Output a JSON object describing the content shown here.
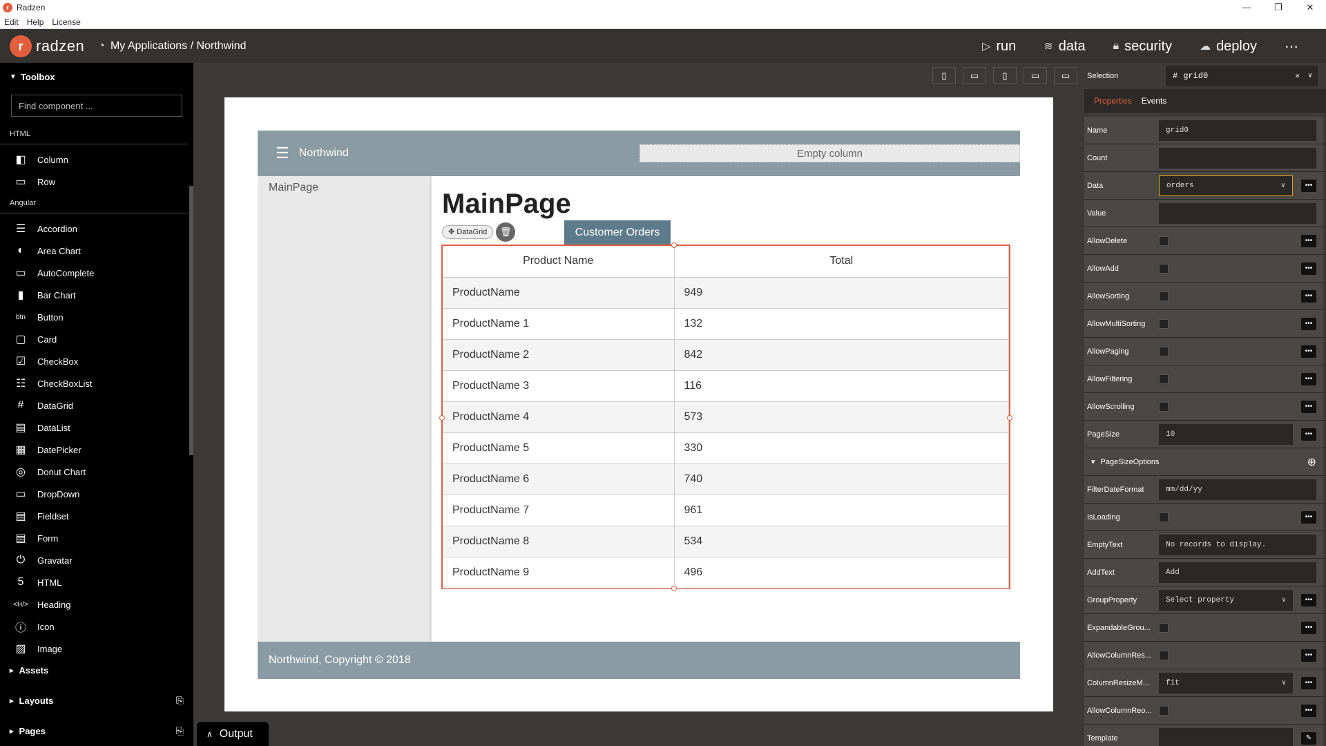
{
  "titlebar": {
    "title": "Radzen",
    "controls": [
      "—",
      "❐",
      "✕"
    ]
  },
  "menubar": {
    "items": [
      "Edit",
      "Help",
      "License"
    ]
  },
  "header": {
    "logo": "radzen",
    "breadcrumb": "My Applications / Northwind",
    "nav": [
      {
        "icon": "play-icon",
        "label": "run",
        "glyph": "▷"
      },
      {
        "icon": "database-icon",
        "label": "data",
        "glyph": "≋"
      },
      {
        "icon": "lock-icon",
        "label": "security",
        "glyph": "🔒︎"
      },
      {
        "icon": "cloud-upload-icon",
        "label": "deploy",
        "glyph": "☁"
      }
    ],
    "more": "⋯"
  },
  "toolbox": {
    "title": "Toolbox",
    "search_placeholder": "Find component ...",
    "sections": [
      {
        "title": "HTML",
        "items": [
          {
            "label": "Column",
            "glyph": "◧"
          },
          {
            "label": "Row",
            "glyph": "▭"
          }
        ]
      },
      {
        "title": "Angular",
        "items": [
          {
            "label": "Accordion",
            "glyph": "☰"
          },
          {
            "label": "Area Chart",
            "glyph": "◐"
          },
          {
            "label": "AutoComplete",
            "glyph": "▭"
          },
          {
            "label": "Bar Chart",
            "glyph": "▮"
          },
          {
            "label": "Button",
            "glyph": "btn"
          },
          {
            "label": "Card",
            "glyph": "▢"
          },
          {
            "label": "CheckBox",
            "glyph": "☑"
          },
          {
            "label": "CheckBoxList",
            "glyph": "☷"
          },
          {
            "label": "DataGrid",
            "glyph": "#"
          },
          {
            "label": "DataList",
            "glyph": "▤"
          },
          {
            "label": "DatePicker",
            "glyph": "▦"
          },
          {
            "label": "Donut Chart",
            "glyph": "◎"
          },
          {
            "label": "DropDown",
            "glyph": "▭"
          },
          {
            "label": "Fieldset",
            "glyph": "▤"
          },
          {
            "label": "Form",
            "glyph": "▤"
          },
          {
            "label": "Gravatar",
            "glyph": "⏻"
          },
          {
            "label": "HTML",
            "glyph": "5"
          },
          {
            "label": "Heading",
            "glyph": "<H/>"
          },
          {
            "label": "Icon",
            "glyph": "ⓘ"
          },
          {
            "label": "Image",
            "glyph": "▨"
          }
        ]
      }
    ],
    "bottom": [
      {
        "label": "Assets",
        "action": ""
      },
      {
        "label": "Layouts",
        "action": "⎘"
      },
      {
        "label": "Pages",
        "action": "⎘"
      }
    ]
  },
  "output": "Output",
  "devices": [
    "▯",
    "▭",
    "▯",
    "▭",
    "▭"
  ],
  "app": {
    "brand": "Northwind",
    "empty_column": "Empty column",
    "nav_link": "MainPage",
    "heading": "MainPage",
    "datagrid_tag": "✥ DataGrid",
    "delete_glyph": "🗑︎",
    "customer_orders": "Customer Orders",
    "grid": {
      "columns": [
        "Product Name",
        "Total"
      ],
      "rows": [
        [
          "ProductName",
          "949"
        ],
        [
          "ProductName 1",
          "132"
        ],
        [
          "ProductName 2",
          "842"
        ],
        [
          "ProductName 3",
          "116"
        ],
        [
          "ProductName 4",
          "573"
        ],
        [
          "ProductName 5",
          "330"
        ],
        [
          "ProductName 6",
          "740"
        ],
        [
          "ProductName 7",
          "961"
        ],
        [
          "ProductName 8",
          "534"
        ],
        [
          "ProductName 9",
          "496"
        ]
      ]
    },
    "footer": "Northwind, Copyright © 2018"
  },
  "panel": {
    "selection_label": "Selection",
    "selection_value": "grid0",
    "tabs": [
      "Properties",
      "Events"
    ],
    "props": [
      {
        "label": "Name",
        "type": "text",
        "value": "grid0",
        "bind": false
      },
      {
        "label": "Count",
        "type": "text",
        "value": "",
        "bind": false
      },
      {
        "label": "Data",
        "type": "select",
        "value": "orders",
        "bind": true,
        "highlight": true
      },
      {
        "label": "Value",
        "type": "text",
        "value": "",
        "bind": false
      },
      {
        "label": "AllowDelete",
        "type": "check",
        "bind": true
      },
      {
        "label": "AllowAdd",
        "type": "check",
        "bind": true
      },
      {
        "label": "AllowSorting",
        "type": "check",
        "bind": true
      },
      {
        "label": "AllowMultiSorting",
        "type": "check",
        "bind": true
      },
      {
        "label": "AllowPaging",
        "type": "check",
        "bind": true
      },
      {
        "label": "AllowFiltering",
        "type": "check",
        "bind": true
      },
      {
        "label": "AllowScrolling",
        "type": "check",
        "bind": true
      },
      {
        "label": "PageSize",
        "type": "text",
        "value": "10",
        "bind": true
      },
      {
        "label": "PageSizeOptions",
        "type": "group",
        "bind": false
      },
      {
        "label": "FilterDateFormat",
        "type": "text",
        "value": "mm/dd/yy",
        "bind": false
      },
      {
        "label": "IsLoading",
        "type": "check",
        "bind": true
      },
      {
        "label": "EmptyText",
        "type": "text",
        "value": "No records to display.",
        "bind": false
      },
      {
        "label": "AddText",
        "type": "text",
        "value": "Add",
        "bind": false
      },
      {
        "label": "GroupProperty",
        "type": "select",
        "value": "Select property",
        "bind": true
      },
      {
        "label": "ExpandableGrou...",
        "type": "check",
        "bind": true
      },
      {
        "label": "AllowColumnRes...",
        "type": "check",
        "bind": true
      },
      {
        "label": "ColumnResizeM...",
        "type": "select",
        "value": "fit",
        "bind": true
      },
      {
        "label": "AllowColumnReo...",
        "type": "check",
        "bind": true
      },
      {
        "label": "Template",
        "type": "text",
        "value": "",
        "bind": true,
        "edit": true
      }
    ]
  }
}
